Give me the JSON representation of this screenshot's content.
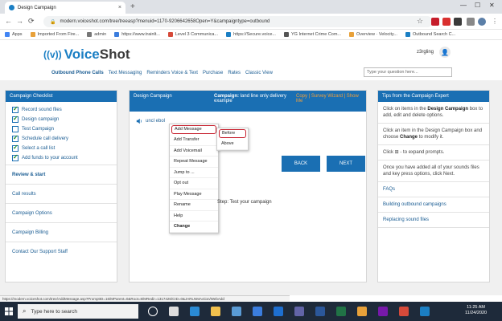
{
  "browser": {
    "tab_title": "Design Campaign",
    "tab_close": "×",
    "new_tab": "+",
    "url": "modern.voiceshot.com/tree/treeasp?menuid=1170-9206642658Open=Y&campaigntype=outbound",
    "lock_glyph": "🔒",
    "win_min": "—",
    "win_max": "☐",
    "win_close": "✕",
    "back_glyph": "←",
    "fwd_glyph": "→",
    "reload_glyph": "⟳",
    "star_glyph": "☆",
    "bookmarks": [
      {
        "label": "Apps",
        "color": "#4285f4"
      },
      {
        "label": "Imported From Fire...",
        "color": "#e8a13a"
      },
      {
        "label": "admin",
        "color": "#777777"
      },
      {
        "label": "https://www.trainlt...",
        "color": "#3b7ddd"
      },
      {
        "label": "Level 3 Communica...",
        "color": "#d64a3a"
      },
      {
        "label": "https://Secure.voice...",
        "color": "#1b7fc4"
      },
      {
        "label": "YG Internet Crime Com...",
        "color": "#555555"
      },
      {
        "label": "Overview · Velocity...",
        "color": "#e8a13a"
      },
      {
        "label": "Outbound Search C...",
        "color": "#1b7fc4"
      }
    ]
  },
  "header": {
    "logo_mark": "((v))",
    "logo_voice": "Voice",
    "logo_shot": "Shot",
    "username": "z3rgling",
    "avatar_glyph": "👤",
    "nav": [
      "Outbound Phone Calls",
      "Text Messaging",
      "Reminders Voice & Text",
      "Purchase",
      "Rates",
      "Classic View"
    ],
    "search_placeholder": "Type your question here..."
  },
  "checklist": {
    "title": "Campaign Checklist",
    "items": [
      {
        "label": "Record sound files",
        "checked": true
      },
      {
        "label": "Design campaign",
        "checked": true
      },
      {
        "label": "Test Campaign",
        "checked": false
      },
      {
        "label": "Schedule call delivery",
        "checked": true
      },
      {
        "label": "Select a call list",
        "checked": true
      },
      {
        "label": "Add funds to your account",
        "checked": true
      }
    ],
    "links": [
      {
        "label": "Review & start",
        "bold": true
      },
      {
        "label": "Call results",
        "bold": false
      },
      {
        "label": "Campaign Options",
        "bold": false
      },
      {
        "label": "Campaign Billing",
        "bold": false
      },
      {
        "label": "Contact Our Support Staff",
        "bold": false
      }
    ]
  },
  "design": {
    "title": "Design Campaign",
    "campaign_label": "Campaign:",
    "campaign_name": "land line only delivery example",
    "copy_link": "Copy | Survey Wizard | Show Me",
    "message_label": "uncl ebol",
    "step_text": "Step: Test your campaign",
    "back_label": "BACK",
    "next_label": "NEXT"
  },
  "context_menu": {
    "items": [
      {
        "label": "Add Message",
        "highlight": true,
        "bold": false
      },
      {
        "label": "Add Transfer",
        "highlight": false,
        "bold": false
      },
      {
        "label": "Add Voicemail",
        "highlight": false,
        "bold": false
      },
      {
        "label": "Repeat Message",
        "highlight": false,
        "bold": false
      },
      {
        "label": "Jump to ...",
        "highlight": false,
        "bold": false
      },
      {
        "label": "Opt out",
        "highlight": false,
        "bold": false
      },
      {
        "label": "Play Message",
        "highlight": false,
        "bold": false
      },
      {
        "label": "Rename",
        "highlight": false,
        "bold": false
      },
      {
        "label": "Help",
        "highlight": false,
        "bold": false
      },
      {
        "label": "Change",
        "highlight": false,
        "bold": true
      }
    ]
  },
  "submenu": {
    "items": [
      {
        "label": "Before",
        "highlight": true
      },
      {
        "label": "Above",
        "highlight": false
      }
    ]
  },
  "tips": {
    "title": "Tips from the Campaign Expert",
    "t1_pre": "Click on items in the ",
    "t1_bold": "Design Campaign",
    "t1_post": " box to add, edit and delete options.",
    "t2_pre": "Click an item in the Design Campaign box and choose ",
    "t2_bold": "Change",
    "t2_post": " to modify it.",
    "t3": "Click ⊞ - to expand prompts.",
    "t4": "Once you have added all of your sounds files and key press options, click Next.",
    "links": [
      "FAQs",
      "Building outbound campaigns",
      "Replacing sound files"
    ]
  },
  "status_url": "https://modern.voiceshot.com/tree/AddMessage.asp?PromptID=16/MParent=0&Root=8/MRedir=1317426/CID=0&JARLNMAction/WebAdd",
  "taskbar": {
    "search_placeholder": "Type here to search",
    "search_glyph": "⌕",
    "time": "11:25 AM",
    "date": "11/24/2020",
    "icons": [
      {
        "name": "cortana-icon",
        "color": "#ffffff"
      },
      {
        "name": "task-view-icon",
        "color": "#dddddd"
      },
      {
        "name": "edge-icon",
        "color": "#2a8ad4"
      },
      {
        "name": "file-explorer-icon",
        "color": "#f2c14e"
      },
      {
        "name": "store-icon",
        "color": "#5a9bd5"
      },
      {
        "name": "mail-icon",
        "color": "#3b7ddd"
      },
      {
        "name": "outlook-icon",
        "color": "#1e6fd0"
      },
      {
        "name": "teams-icon",
        "color": "#6264a7"
      },
      {
        "name": "word-icon",
        "color": "#2b579a"
      },
      {
        "name": "excel-icon",
        "color": "#217346"
      },
      {
        "name": "chrome-icon",
        "color": "#e8a13a"
      },
      {
        "name": "onenote-icon",
        "color": "#7719aa"
      },
      {
        "name": "app-red-icon",
        "color": "#d64a3a"
      },
      {
        "name": "app-blue-icon",
        "color": "#1b7fc4"
      }
    ]
  }
}
